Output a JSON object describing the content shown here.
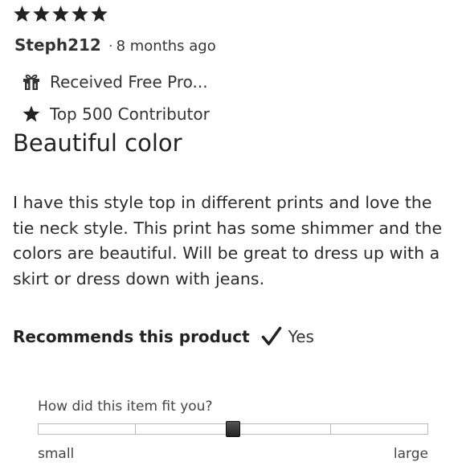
{
  "review": {
    "rating": 5,
    "rating_max": 5,
    "username": "Steph212",
    "separator": "·",
    "time_ago": "8 months ago",
    "badges": [
      {
        "icon": "gift-icon",
        "label": "Received Free Pro..."
      },
      {
        "icon": "star-icon",
        "label": "Top 500 Contributor"
      }
    ],
    "title": "Beautiful color",
    "body": "I have this style top in different prints and love the tie neck style. This print has some shimmer and the colors are beautiful. Will be great to dress up with a skirt or dress down with jeans.",
    "recommend": {
      "label": "Recommends this product",
      "icon": "checkmark-icon",
      "value": "Yes"
    },
    "fit": {
      "question": "How did this item fit you?",
      "min_label": "small",
      "max_label": "large",
      "segments": 4,
      "value": 0.5
    }
  }
}
